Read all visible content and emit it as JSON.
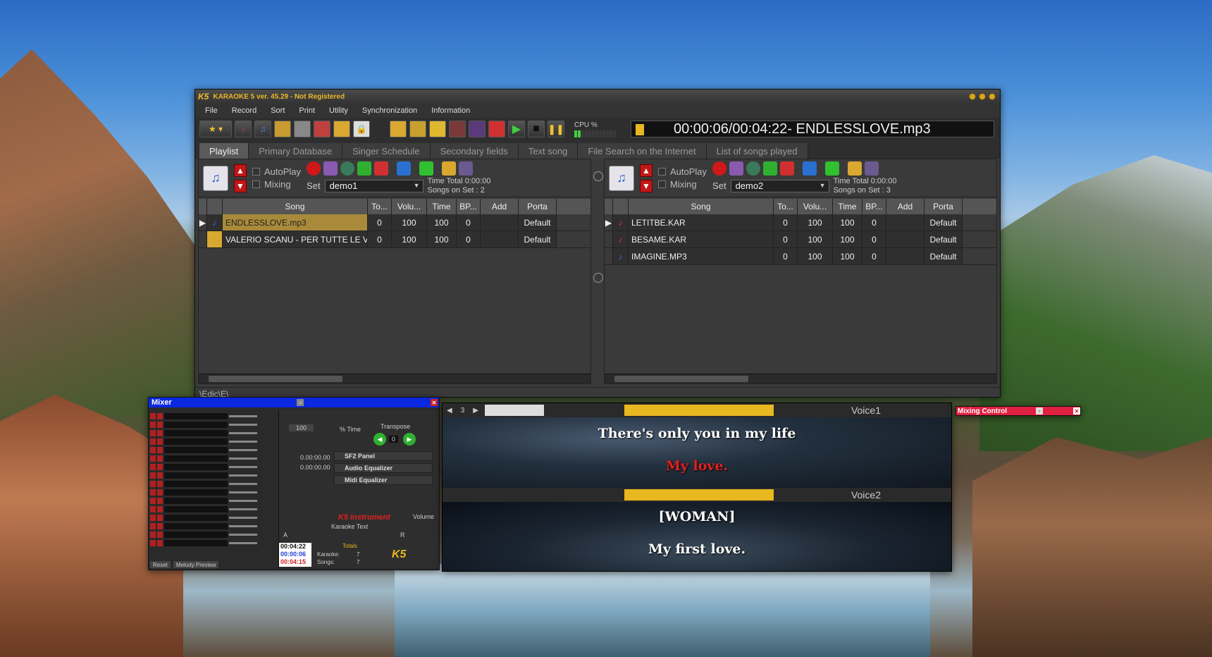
{
  "app": {
    "logo": "K5",
    "title": "KARAOKE 5   ver. 45.29 - Not Registered"
  },
  "menu": [
    "File",
    "Record",
    "Sort",
    "Print",
    "Utility",
    "Synchronization",
    "Information"
  ],
  "toolbar": {
    "cpu_label": "CPU %",
    "clock": "00:00:06/00:04:22- ENDLESSLOVE.mp3"
  },
  "tabs": [
    "Playlist",
    "Primary Database",
    "Singer Schedule",
    "Secondary fields",
    "Text song",
    "File Search on the Internet",
    "List of songs played"
  ],
  "left_panel": {
    "autoplay": "AutoPlay",
    "mixing": "Mixing",
    "set_label": "Set",
    "set_value": "demo1",
    "time_total": "Time Total  0:00:00",
    "songs_on_set": "Songs on Set : 2"
  },
  "right_panel": {
    "autoplay": "AutoPlay",
    "mixing": "Mixing",
    "set_label": "Set",
    "set_value": "demo2",
    "time_total": "Time Total  0:00:00",
    "songs_on_set": "Songs on Set : 3"
  },
  "columns": [
    "Song",
    "To...",
    "Volu...",
    "Time",
    "BP...",
    "Add",
    "Porta"
  ],
  "left_rows": [
    {
      "song": "ENDLESSLOVE.mp3",
      "to": "0",
      "vol": "100",
      "time": "100",
      "bp": "0",
      "add": "",
      "porta": "Default"
    },
    {
      "song": "VALERIO SCANU - PER TUTTE LE VO",
      "to": "0",
      "vol": "100",
      "time": "100",
      "bp": "0",
      "add": "",
      "porta": "Default"
    }
  ],
  "right_rows": [
    {
      "song": "LETITBE.KAR",
      "to": "0",
      "vol": "100",
      "time": "100",
      "bp": "0",
      "add": "",
      "porta": "Default"
    },
    {
      "song": "BESAME.KAR",
      "to": "0",
      "vol": "100",
      "time": "100",
      "bp": "0",
      "add": "",
      "porta": "Default"
    },
    {
      "song": "IMAGINE.MP3",
      "to": "0",
      "vol": "100",
      "time": "100",
      "bp": "0",
      "add": "",
      "porta": "Default"
    }
  ],
  "status_path": "\\Edic\\E\\",
  "mixer": {
    "title": "Mixer",
    "tempo_value": "100",
    "time_label": "% Time",
    "transpose_label": "Transpose",
    "transpose_value": "0",
    "counter1": "0.00:00.00",
    "counter2": "0.00:00.00",
    "sf2": "SF2 Panel",
    "audio_eq": "Audio Equalizer",
    "midi_eq": "Midi Equalizer",
    "instrument": "K5 Instrument",
    "volume": "Volume",
    "karaoke_text": "Karaoke Text",
    "a_label": "A",
    "r_label": "R",
    "t1": "00:04:22",
    "t2": "00:00:06",
    "t3": "00:04:15",
    "totals": "Totals",
    "karaoke_label": "Karaoke:",
    "karaoke_count": "7",
    "songs_label": "Songs:",
    "songs_count": "7",
    "reset": "Reset",
    "melody_preview": "Melody Preview"
  },
  "lyrics": {
    "page": "3",
    "voice1": "Voice1",
    "voice2": "Voice2",
    "line1": "There's only you in my life",
    "line2": "My love.",
    "line3": "[WOMAN]",
    "line4": "My first love."
  },
  "mixing_control": {
    "title": "Mixing Control"
  }
}
